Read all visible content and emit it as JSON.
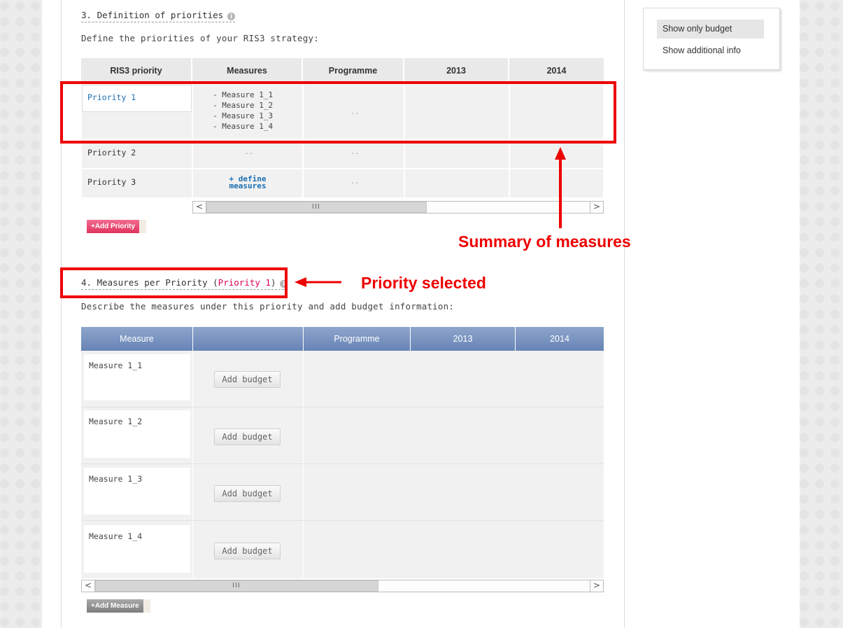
{
  "section3": {
    "title": "3. Definition of priorities",
    "description": "Define the priorities of your RIS3 strategy:",
    "columns": [
      "RIS3 priority",
      "Measures",
      "Programme",
      "2013",
      "2014"
    ],
    "rows": [
      {
        "priority": "Priority 1",
        "measures": [
          "- Measure 1_1",
          "- Measure 1_2",
          "- Measure 1_3",
          "- Measure 1_4"
        ],
        "programme": "--"
      },
      {
        "priority": "Priority 2",
        "measures_placeholder": "--",
        "programme": "--"
      },
      {
        "priority": "Priority 3",
        "define_link": "+ define measures",
        "programme": "--"
      }
    ],
    "add_button": "+Add Priority",
    "scroll_grip": "III",
    "scroll_left": "<",
    "scroll_right": ">"
  },
  "section4": {
    "title_prefix": "4. Measures per Priority (",
    "selected_priority": "Priority 1",
    "title_suffix": ")",
    "description": "Describe the measures under this priority and add budget information:",
    "columns": [
      "Measure",
      "",
      "Programme",
      "2013",
      "2014"
    ],
    "rows": [
      {
        "measure": "Measure 1_1",
        "button": "Add budget"
      },
      {
        "measure": "Measure 1_2",
        "button": "Add budget"
      },
      {
        "measure": "Measure 1_3",
        "button": "Add budget"
      },
      {
        "measure": "Measure 1_4",
        "button": "Add budget"
      }
    ],
    "add_button": "+Add Measure",
    "scroll_grip": "III",
    "scroll_left": "<",
    "scroll_right": ">"
  },
  "side_menu": {
    "items": [
      "Show only budget",
      "Show additional info"
    ]
  },
  "annotations": {
    "summary": "Summary of measures",
    "priority_selected": "Priority selected"
  },
  "colors": {
    "annotation_red": "#ee0000",
    "link_blue": "#1a6fb3",
    "highlight_pink": "#d8005a",
    "header_blue": "#7a94c0"
  }
}
